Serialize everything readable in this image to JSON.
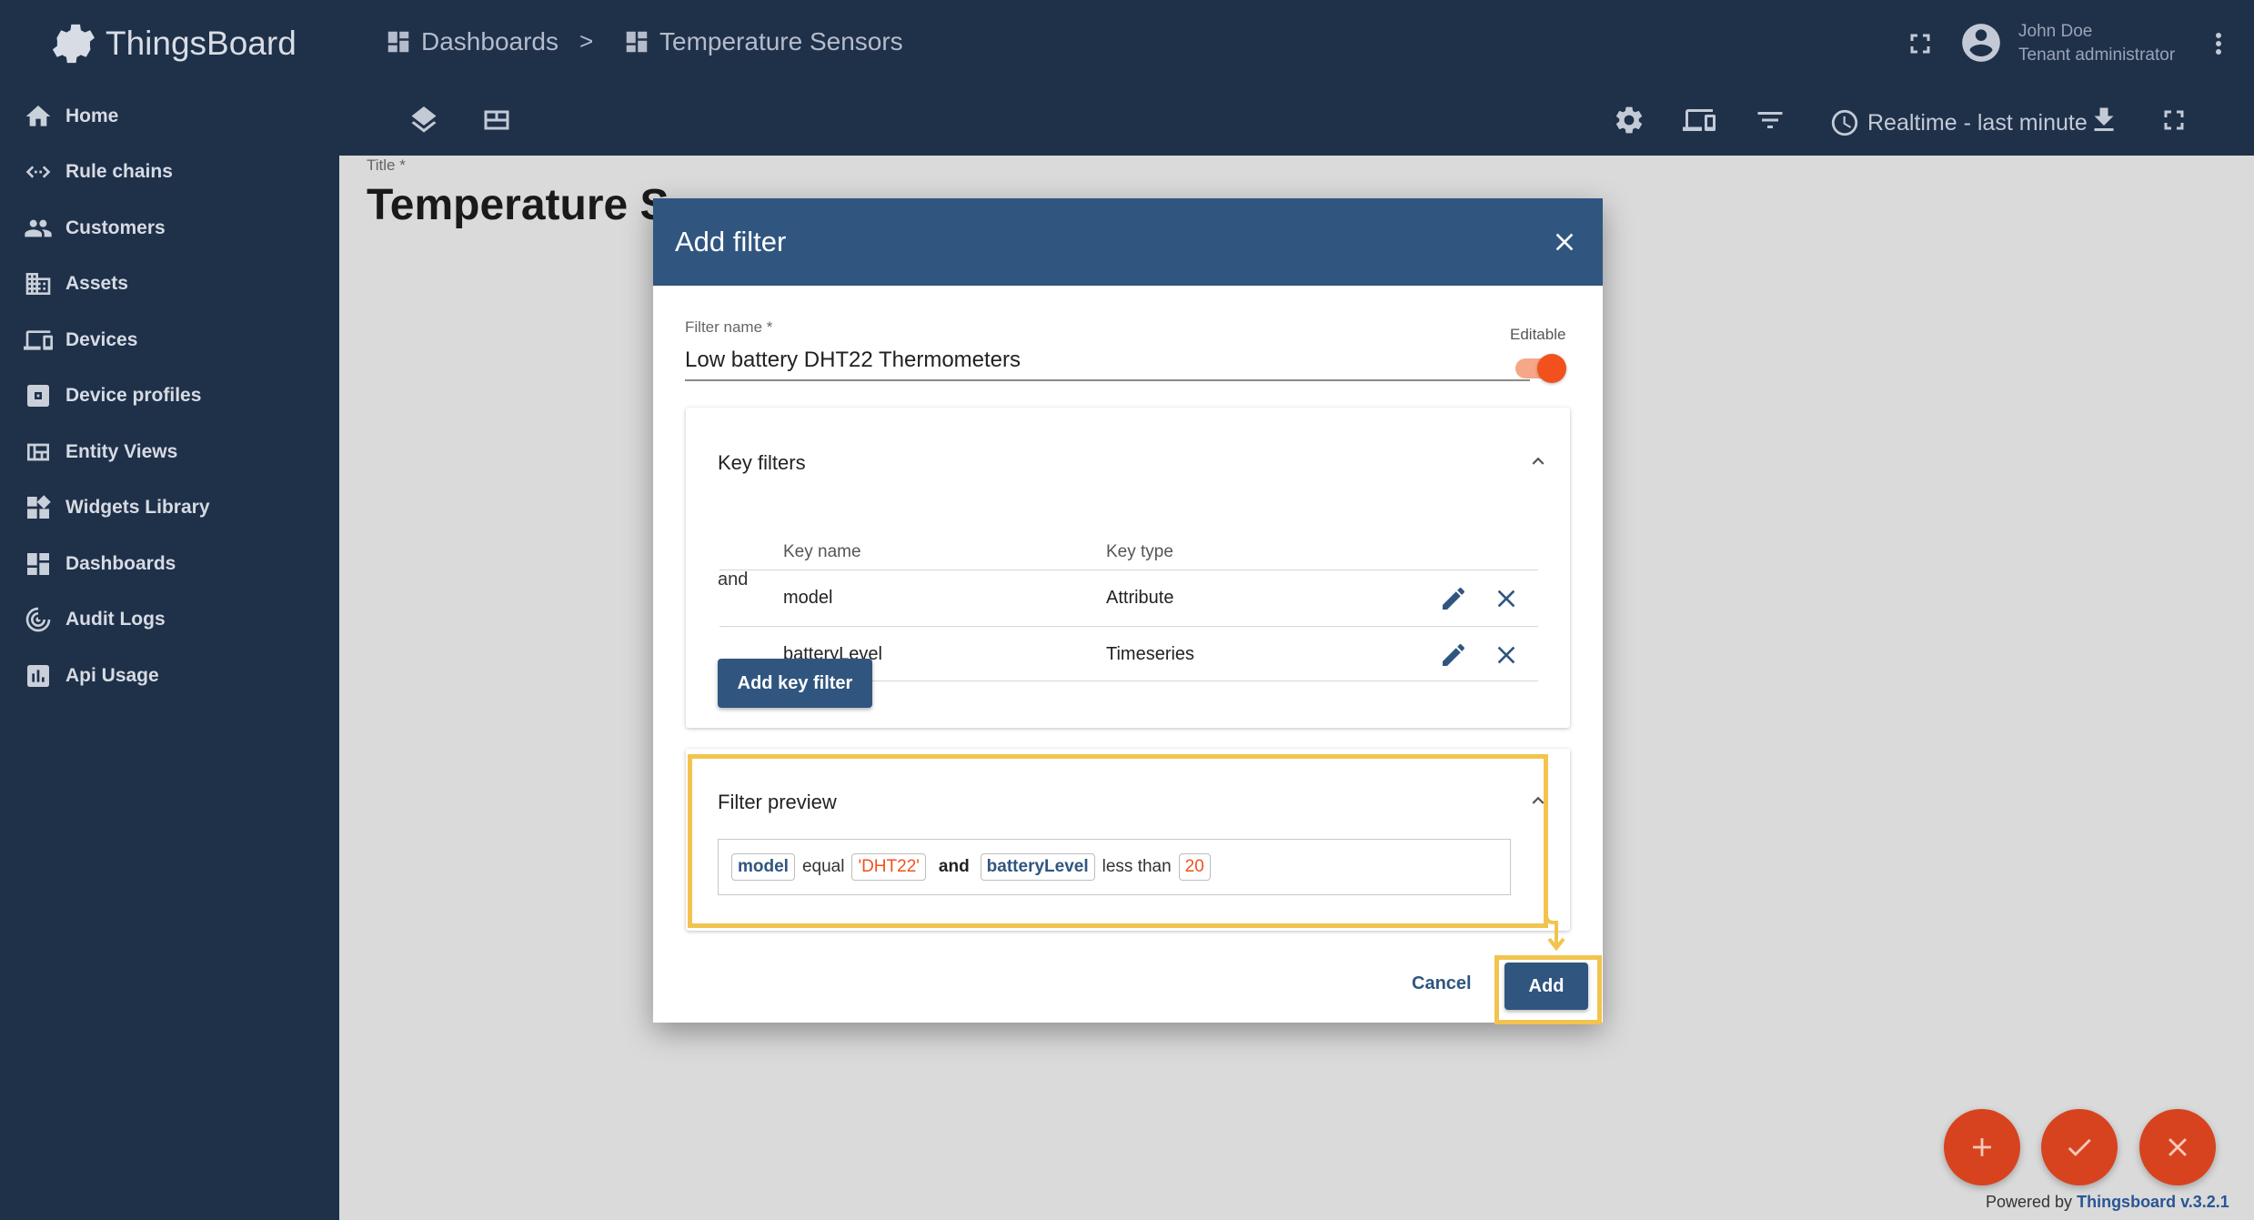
{
  "app": {
    "name": "ThingsBoard"
  },
  "sidebar": {
    "items": [
      {
        "label": "Home",
        "icon": "home-icon"
      },
      {
        "label": "Rule chains",
        "icon": "rule-chain-icon"
      },
      {
        "label": "Customers",
        "icon": "customers-icon"
      },
      {
        "label": "Assets",
        "icon": "assets-icon"
      },
      {
        "label": "Devices",
        "icon": "devices-icon"
      },
      {
        "label": "Device profiles",
        "icon": "device-profile-icon"
      },
      {
        "label": "Entity Views",
        "icon": "entity-views-icon"
      },
      {
        "label": "Widgets Library",
        "icon": "widgets-icon"
      },
      {
        "label": "Dashboards",
        "icon": "dashboards-icon"
      },
      {
        "label": "Audit Logs",
        "icon": "audit-logs-icon"
      },
      {
        "label": "Api Usage",
        "icon": "api-usage-icon"
      }
    ]
  },
  "header": {
    "breadcrumb": [
      {
        "label": "Dashboards"
      },
      {
        "label": "Temperature Sensors"
      }
    ],
    "separator": ">",
    "user_name": "John Doe",
    "user_role": "Tenant administrator",
    "timewindow": "Realtime - last minute"
  },
  "dashboard": {
    "title_label": "Title *",
    "title": "Temperature S"
  },
  "dialog": {
    "title": "Add filter",
    "filter_name_label": "Filter name *",
    "filter_name_value": "Low battery DHT22 Thermometers",
    "editable_label": "Editable",
    "editable": true,
    "key_filters": {
      "title": "Key filters",
      "col_key_name": "Key name",
      "col_key_type": "Key type",
      "operator": "and",
      "rows": [
        {
          "key_name": "model",
          "key_type": "Attribute"
        },
        {
          "key_name": "batteryLevel",
          "key_type": "Timeseries"
        }
      ],
      "add_button": "Add key filter"
    },
    "preview": {
      "title": "Filter preview",
      "key1": "model",
      "op1": "equal",
      "val1": "'DHT22'",
      "joiner": "and",
      "key2": "batteryLevel",
      "op2": "less than",
      "val2": "20"
    },
    "cancel": "Cancel",
    "add": "Add"
  },
  "footer": {
    "powered_by": "Powered by",
    "version": "Thingsboard v.3.2.1"
  },
  "colors": {
    "sidebar": "#1f3049",
    "dialog_header": "#305680",
    "accent": "#f2511d",
    "highlight": "#f2c44e"
  }
}
